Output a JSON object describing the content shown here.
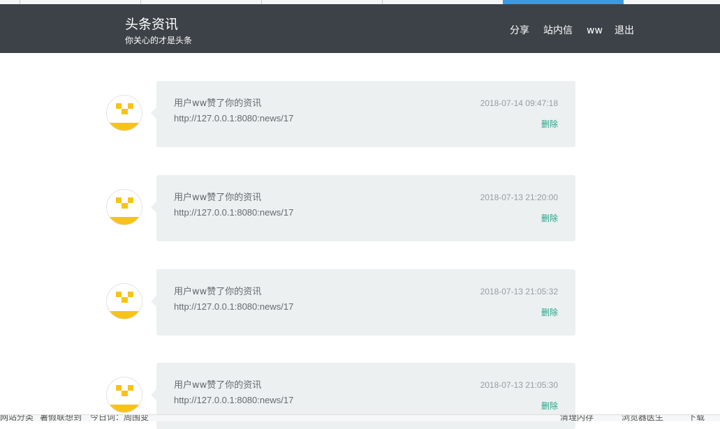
{
  "brand": {
    "title": "头条资讯",
    "subtitle": "你关心的才是头条"
  },
  "nav": {
    "share": "分享",
    "messages": "站内信",
    "user": "ww",
    "logout": "退出"
  },
  "items": [
    {
      "message": "用户ww赞了你的资讯",
      "link": "http://127.0.0.1:8080:news/17",
      "time": "2018-07-14 09:47:18",
      "delete": "删除"
    },
    {
      "message": "用户ww赞了你的资讯",
      "link": "http://127.0.0.1:8080:news/17",
      "time": "2018-07-13 21:20:00",
      "delete": "删除"
    },
    {
      "message": "用户ww赞了你的资讯",
      "link": "http://127.0.0.1:8080:news/17",
      "time": "2018-07-13 21:05:32",
      "delete": "删除"
    },
    {
      "message": "用户ww赞了你的资讯",
      "link": "http://127.0.0.1:8080:news/17",
      "time": "2018-07-13 21:05:30",
      "delete": "删除"
    }
  ],
  "statusbar": {
    "text1": "网站分类",
    "text2": "暑假联想到",
    "text3": "今日词：周围变",
    "clean": "清理内存",
    "doctor": "浏览器医生",
    "extra": "下载"
  },
  "colors": {
    "header": "#3d4248",
    "bubble": "#ecf0f1",
    "delete_link": "#26a48a",
    "avatar_yellow": "#f6c319"
  }
}
